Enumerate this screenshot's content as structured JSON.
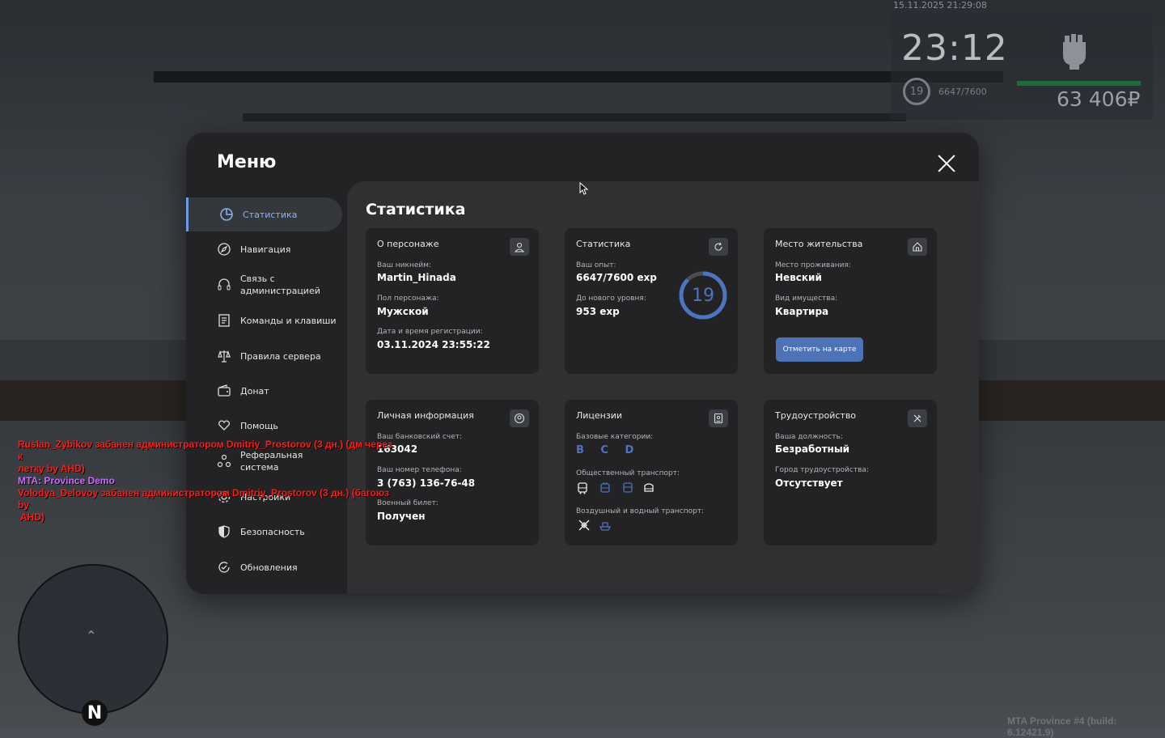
{
  "hud": {
    "datetime": "15.11.2025 21:29:08",
    "time": "23:12",
    "level": "19",
    "exp": "6647/7600",
    "money": "63 406₽"
  },
  "chat": [
    {
      "text": "Ruslan_Zybikov забанен администратором Dmitriy_Prostorov (3 дн.) (дм через к",
      "color": "red"
    },
    {
      "text": "летку by AHD)",
      "color": "red"
    },
    {
      "text": "MTA: Province Demo",
      "color": "purple"
    },
    {
      "text": "Volodya_Delovoy забанен администратором Dmitriy_Prostorov (3 дн.) (багоюз by",
      "color": "red"
    },
    {
      "text": " AHD)",
      "color": "red"
    }
  ],
  "build": "MTA Province #4 (build: 6.12421.9)",
  "minimap": {
    "north": "N"
  },
  "menu": {
    "title": "Меню",
    "sidebar": [
      {
        "label": "Статистика",
        "icon": "pie-chart-icon",
        "active": true
      },
      {
        "label": "Навигация",
        "icon": "compass-icon"
      },
      {
        "label": "Связь с администрацией",
        "icon": "headset-icon"
      },
      {
        "label": "Команды и клавиши",
        "icon": "document-list-icon"
      },
      {
        "label": "Правила сервера",
        "icon": "scales-icon"
      },
      {
        "label": "Донат",
        "icon": "wallet-icon"
      },
      {
        "label": "Помощь",
        "icon": "hand-heart-icon"
      },
      {
        "label": "Реферальная система",
        "icon": "people-network-icon"
      },
      {
        "label": "Настройки",
        "icon": "gear-icon"
      },
      {
        "label": "Безопасность",
        "icon": "shield-icon"
      },
      {
        "label": "Обновления",
        "icon": "refresh-check-icon"
      }
    ],
    "section_title": "Статистика",
    "cards": {
      "character": {
        "title": "О персонаже",
        "icon": "user-icon",
        "nickname_label": "Ваш никнейм:",
        "nickname": "Martin_Hinada",
        "gender_label": "Пол персонажа:",
        "gender": "Мужской",
        "reg_label": "Дата и время регистрации:",
        "reg": "03.11.2024 23:55:22"
      },
      "stats": {
        "title": "Статистика",
        "icon": "refresh-icon",
        "exp_label": "Ваш опыт:",
        "exp": "6647/7600 exp",
        "next_label": "До нового уровня:",
        "next": "953 exp",
        "level": "19",
        "progress": 0.875
      },
      "residence": {
        "title": "Место жительства",
        "icon": "house-icon",
        "place_label": "Место проживания:",
        "place": "Невский",
        "property_label": "Вид имущества:",
        "property": "Квартира",
        "button": "Отметить на карте"
      },
      "personal": {
        "title": "Личная информация",
        "icon": "user-circle-icon",
        "bank_label": "Ваш банковский счет:",
        "bank": "163042",
        "phone_label": "Ваш номер телефона:",
        "phone": "3 (763) 136-76-48",
        "military_label": "Военный билет:",
        "military": "Получен"
      },
      "licenses": {
        "title": "Лицензии",
        "icon": "id-card-icon",
        "basic_label": "Базовые категории:",
        "basic": "B C D",
        "public_label": "Общественный транспорт:",
        "air_label": "Воздушный и водный транспорт:"
      },
      "job": {
        "title": "Трудоустройство",
        "icon": "tools-icon",
        "position_label": "Ваша должность:",
        "position": "Безработный",
        "city_label": "Город трудоустройства:",
        "city": "Отсутствует"
      }
    }
  }
}
